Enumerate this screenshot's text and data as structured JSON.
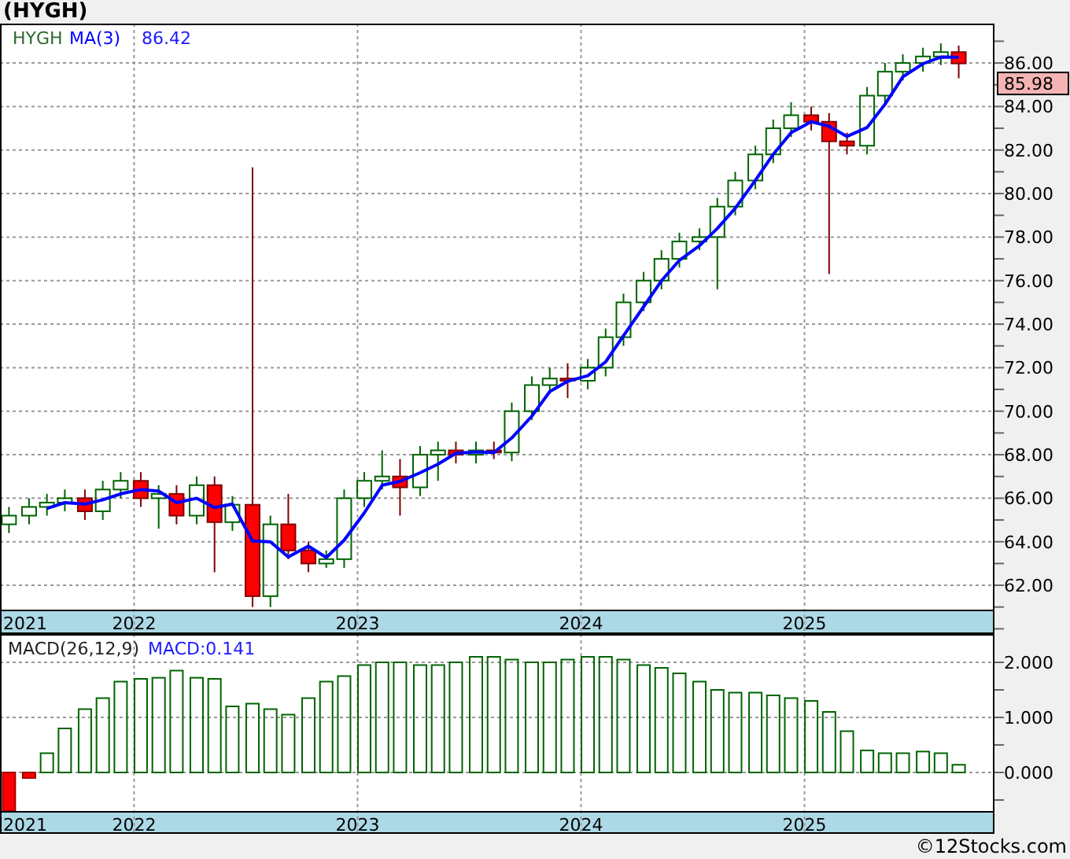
{
  "title": "(HYGH)",
  "price_panel": {
    "legend": {
      "symbol": "HYGH",
      "indicator_value": "86.42"
    },
    "last_price": "85.98",
    "chart_data": {
      "type": "candlestick",
      "grid": true,
      "xlim": [
        2021.4,
        2025.85
      ],
      "ylim": [
        59.76,
        87.81
      ],
      "yticks": [
        {
          "value": 62,
          "label": "62.00"
        },
        {
          "value": 64,
          "label": "64.00"
        },
        {
          "value": 66,
          "label": "66.00"
        },
        {
          "value": 68,
          "label": "68.00"
        },
        {
          "value": 70,
          "label": "70.00"
        },
        {
          "value": 72,
          "label": "72.00"
        },
        {
          "value": 74,
          "label": "74.00"
        },
        {
          "value": 76,
          "label": "76.00"
        },
        {
          "value": 78,
          "label": "78.00"
        },
        {
          "value": 80,
          "label": "80.00"
        },
        {
          "value": 82,
          "label": "82.00"
        },
        {
          "value": 84,
          "label": "84.00"
        },
        {
          "value": 86,
          "label": "86.00"
        }
      ],
      "xticks": [
        {
          "value": 2021.4,
          "label": "2021"
        },
        {
          "value": 2022,
          "label": "2022"
        },
        {
          "value": 2023,
          "label": "2023"
        },
        {
          "value": 2024,
          "label": "2024"
        },
        {
          "value": 2025,
          "label": "2025"
        }
      ],
      "x": [
        2021.44,
        2021.53,
        2021.61,
        2021.69,
        2021.78,
        2021.86,
        2021.94,
        2022.03,
        2022.11,
        2022.19,
        2022.28,
        2022.36,
        2022.44,
        2022.53,
        2022.61,
        2022.69,
        2022.78,
        2022.86,
        2022.94,
        2023.03,
        2023.11,
        2023.19,
        2023.28,
        2023.36,
        2023.44,
        2023.53,
        2023.61,
        2023.69,
        2023.78,
        2023.86,
        2023.94,
        2024.03,
        2024.11,
        2024.19,
        2024.28,
        2024.36,
        2024.44,
        2024.53,
        2024.61,
        2024.69,
        2024.78,
        2024.86,
        2024.94,
        2025.03,
        2025.11,
        2025.19,
        2025.28,
        2025.36,
        2025.44,
        2025.53,
        2025.61,
        2025.69
      ],
      "ohlc": [
        [
          64.8,
          65.6,
          64.4,
          65.2
        ],
        [
          65.2,
          66.0,
          64.8,
          65.6
        ],
        [
          65.6,
          66.2,
          65.2,
          65.8
        ],
        [
          65.8,
          66.4,
          65.4,
          66.0
        ],
        [
          66.0,
          66.4,
          65.0,
          65.4
        ],
        [
          65.4,
          66.8,
          65.0,
          66.4
        ],
        [
          66.4,
          67.2,
          66.0,
          66.8
        ],
        [
          66.8,
          67.2,
          65.6,
          66.0
        ],
        [
          66.0,
          66.6,
          64.6,
          66.2
        ],
        [
          66.2,
          66.6,
          64.8,
          65.2
        ],
        [
          65.2,
          67.0,
          64.8,
          66.6
        ],
        [
          66.6,
          67.0,
          62.6,
          64.9
        ],
        [
          64.9,
          66.1,
          64.5,
          65.7
        ],
        [
          65.7,
          81.2,
          61.0,
          61.5
        ],
        [
          61.5,
          65.2,
          61.0,
          64.8
        ],
        [
          64.8,
          66.2,
          63.2,
          63.6
        ],
        [
          63.6,
          64.0,
          62.6,
          63.0
        ],
        [
          63.0,
          63.6,
          62.8,
          63.2
        ],
        [
          63.2,
          66.4,
          62.8,
          66.0
        ],
        [
          66.0,
          67.2,
          65.6,
          66.8
        ],
        [
          66.8,
          68.2,
          66.4,
          67.0
        ],
        [
          67.0,
          67.8,
          65.2,
          66.5
        ],
        [
          66.5,
          68.4,
          66.1,
          68.0
        ],
        [
          68.0,
          68.6,
          66.8,
          68.2
        ],
        [
          68.2,
          68.6,
          67.6,
          68.0
        ],
        [
          68.0,
          68.6,
          67.6,
          68.2
        ],
        [
          68.2,
          68.6,
          67.8,
          68.1
        ],
        [
          68.1,
          70.4,
          67.7,
          70.0
        ],
        [
          70.0,
          71.6,
          69.6,
          71.2
        ],
        [
          71.2,
          72.0,
          70.8,
          71.5
        ],
        [
          71.5,
          72.2,
          70.6,
          71.4
        ],
        [
          71.4,
          72.4,
          71.0,
          72.0
        ],
        [
          72.0,
          73.8,
          71.6,
          73.4
        ],
        [
          73.4,
          75.4,
          73.0,
          75.0
        ],
        [
          75.0,
          76.4,
          74.6,
          76.0
        ],
        [
          76.0,
          77.4,
          75.6,
          77.0
        ],
        [
          77.0,
          78.2,
          76.6,
          77.8
        ],
        [
          77.8,
          78.4,
          77.4,
          78.0
        ],
        [
          78.0,
          79.8,
          75.6,
          79.4
        ],
        [
          79.4,
          81.0,
          79.0,
          80.6
        ],
        [
          80.6,
          82.2,
          80.2,
          81.8
        ],
        [
          81.8,
          83.4,
          81.4,
          83.0
        ],
        [
          83.0,
          84.2,
          82.6,
          83.6
        ],
        [
          83.6,
          84.0,
          82.9,
          83.3
        ],
        [
          83.3,
          83.7,
          76.3,
          82.4
        ],
        [
          82.4,
          82.8,
          81.8,
          82.2
        ],
        [
          82.2,
          84.9,
          81.8,
          84.5
        ],
        [
          84.5,
          86.0,
          84.1,
          85.6
        ],
        [
          85.6,
          86.4,
          85.2,
          86.0
        ],
        [
          86.0,
          86.7,
          85.6,
          86.3
        ],
        [
          86.3,
          86.9,
          85.9,
          86.5
        ],
        [
          86.5,
          86.8,
          85.3,
          85.98
        ]
      ]
    },
    "moving_average": {
      "chart_data": {
        "type": "line",
        "xlim": [
          2021.4,
          2025.85
        ],
        "ylim": [
          59.76,
          87.81
        ],
        "x": [
          2021.61,
          2021.69,
          2021.78,
          2021.86,
          2021.94,
          2022.03,
          2022.11,
          2022.19,
          2022.28,
          2022.36,
          2022.44,
          2022.53,
          2022.61,
          2022.69,
          2022.78,
          2022.86,
          2022.94,
          2023.03,
          2023.11,
          2023.19,
          2023.28,
          2023.36,
          2023.44,
          2023.53,
          2023.61,
          2023.69,
          2023.78,
          2023.86,
          2023.94,
          2024.03,
          2024.11,
          2024.19,
          2024.28,
          2024.36,
          2024.44,
          2024.53,
          2024.61,
          2024.69,
          2024.78,
          2024.86,
          2024.94,
          2025.03,
          2025.11,
          2025.19,
          2025.28,
          2025.36,
          2025.44,
          2025.53,
          2025.61,
          2025.69
        ],
        "series": [
          {
            "name": "MA(3)",
            "color": "#0000ff",
            "values": [
              65.53,
              65.8,
              65.73,
              65.93,
              66.2,
              66.4,
              66.33,
              65.8,
              66.0,
              65.57,
              65.73,
              64.03,
              64.0,
              63.3,
              63.8,
              63.27,
              64.07,
              65.33,
              66.6,
              66.77,
              67.17,
              67.57,
              68.07,
              68.13,
              68.1,
              68.77,
              69.77,
              70.9,
              71.37,
              71.63,
              72.27,
              73.47,
              74.8,
              76.0,
              76.93,
              77.6,
              78.4,
              79.33,
              80.6,
              81.8,
              82.8,
              83.3,
              83.1,
              82.63,
              83.03,
              84.1,
              85.37,
              85.97,
              86.27,
              86.26
            ]
          }
        ]
      }
    }
  },
  "macd_panel": {
    "legend": {
      "label": "MACD(26,12,9)",
      "value": "MACD:0.141"
    },
    "chart_data": {
      "type": "bar",
      "grid": true,
      "xlim": [
        2021.4,
        2025.85
      ],
      "ylim": [
        -0.714,
        2.514
      ],
      "yticks": [
        {
          "value": 0,
          "label": "0.000"
        },
        {
          "value": 1,
          "label": "1.000"
        },
        {
          "value": 2,
          "label": "2.000"
        }
      ],
      "xticks": [
        {
          "value": 2021.4,
          "label": "2021"
        },
        {
          "value": 2022,
          "label": "2022"
        },
        {
          "value": 2023,
          "label": "2023"
        },
        {
          "value": 2024,
          "label": "2024"
        },
        {
          "value": 2025,
          "label": "2025"
        }
      ],
      "x": [
        2021.44,
        2021.53,
        2021.61,
        2021.69,
        2021.78,
        2021.86,
        2021.94,
        2022.03,
        2022.11,
        2022.19,
        2022.28,
        2022.36,
        2022.44,
        2022.53,
        2022.61,
        2022.69,
        2022.78,
        2022.86,
        2022.94,
        2023.03,
        2023.11,
        2023.19,
        2023.28,
        2023.36,
        2023.44,
        2023.53,
        2023.61,
        2023.69,
        2023.78,
        2023.86,
        2023.94,
        2024.03,
        2024.11,
        2024.19,
        2024.28,
        2024.36,
        2024.44,
        2024.53,
        2024.61,
        2024.69,
        2024.78,
        2024.86,
        2024.94,
        2025.03,
        2025.11,
        2025.19,
        2025.28,
        2025.36,
        2025.44,
        2025.53,
        2025.61,
        2025.69
      ],
      "values": [
        -0.7,
        -0.1,
        0.35,
        0.8,
        1.15,
        1.35,
        1.65,
        1.7,
        1.72,
        1.85,
        1.72,
        1.7,
        1.2,
        1.25,
        1.15,
        1.05,
        1.35,
        1.65,
        1.75,
        1.95,
        2.0,
        2.0,
        1.95,
        1.95,
        2.0,
        2.1,
        2.1,
        2.05,
        2.0,
        2.0,
        2.05,
        2.1,
        2.1,
        2.05,
        1.95,
        1.9,
        1.8,
        1.65,
        1.5,
        1.45,
        1.45,
        1.4,
        1.35,
        1.3,
        1.1,
        0.75,
        0.4,
        0.35,
        0.35,
        0.38,
        0.35,
        0.14
      ]
    }
  },
  "footer": "©12Stocks.com"
}
